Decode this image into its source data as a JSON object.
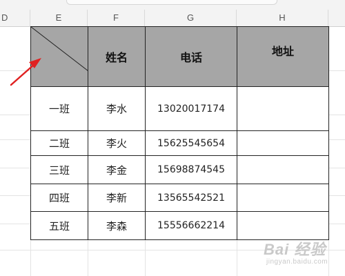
{
  "columns": [
    "D",
    "E",
    "F",
    "G",
    "H"
  ],
  "table": {
    "headers": [
      "姓名",
      "电话",
      "地址"
    ],
    "rows": [
      {
        "class": "一班",
        "name": "李水",
        "phone": "13020017174",
        "address": ""
      },
      {
        "class": "二班",
        "name": "李火",
        "phone": "15625545654",
        "address": ""
      },
      {
        "class": "三班",
        "name": "李金",
        "phone": "15698874545",
        "address": ""
      },
      {
        "class": "四班",
        "name": "李新",
        "phone": "13565542521",
        "address": ""
      },
      {
        "class": "五班",
        "name": "李森",
        "phone": "15556662214",
        "address": ""
      }
    ]
  },
  "watermark": {
    "brand": "Bai 经验",
    "url": "jingyan.baidu.com"
  },
  "colors": {
    "header_fill": "#a6a6a6",
    "arrow": "#e02020",
    "grid": "#e3e3e3"
  }
}
